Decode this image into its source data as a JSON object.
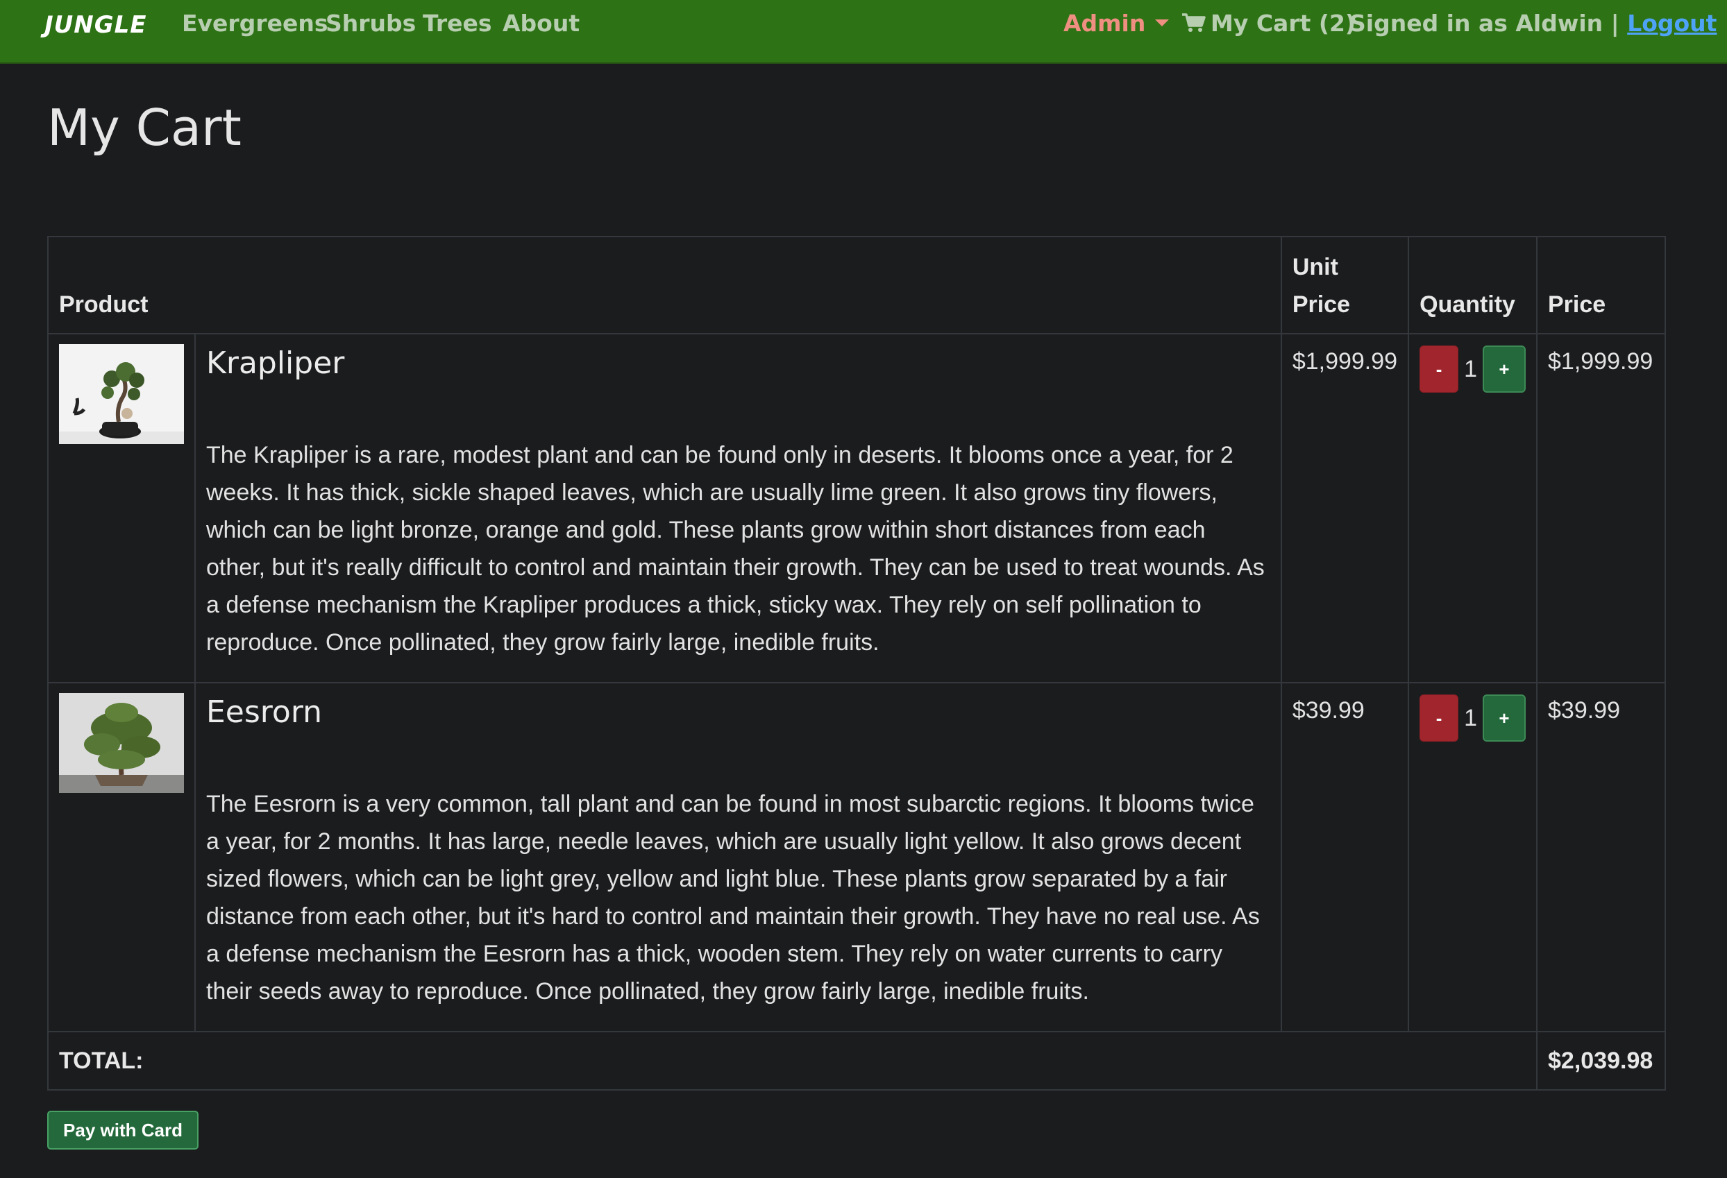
{
  "navbar": {
    "brand": "JUNGLE",
    "links": [
      "Evergreens",
      "Shrubs",
      "Trees",
      "About"
    ],
    "admin_label": "Admin",
    "cart_label": "My Cart (2)",
    "signed_in": "Signed in as Aldwin |",
    "logout": "Logout",
    "colors": {
      "bar": "#2e7216",
      "admin": "#ef8f81",
      "logout": "#4fa3f7"
    }
  },
  "page": {
    "title": "My Cart"
  },
  "table": {
    "headers": {
      "product": "Product",
      "unit_price": "Unit Price",
      "quantity": "Quantity",
      "price": "Price"
    },
    "items": [
      {
        "name": "Krapliper",
        "description": "The Krapliper is a rare, modest plant and can be found only in deserts. It blooms once a year, for 2 weeks. It has thick, sickle shaped leaves, which are usually lime green. It also grows tiny flowers, which can be light bronze, orange and gold. These plants grow within short distances from each other, but it's really difficult to control and maintain their growth. They can be used to treat wounds. As a defense mechanism the Krapliper produces a thick, sticky wax. They rely on self pollination to reproduce. Once pollinated, they grow fairly large, inedible fruits.",
        "unit_price": "$1,999.99",
        "quantity": "1",
        "price": "$1,999.99",
        "minus_label": "-",
        "plus_label": "+"
      },
      {
        "name": "Eesrorn",
        "description": "The Eesrorn is a very common, tall plant and can be found in most subarctic regions. It blooms twice a year, for 2 months. It has large, needle leaves, which are usually light yellow. It also grows decent sized flowers, which can be light grey, yellow and light blue. These plants grow separated by a fair distance from each other, but it's hard to control and maintain their growth. They have no real use. As a defense mechanism the Eesrorn has a thick, wooden stem. They rely on water currents to carry their seeds away to reproduce. Once pollinated, they grow fairly large, inedible fruits.",
        "unit_price": "$39.99",
        "quantity": "1",
        "price": "$39.99",
        "minus_label": "-",
        "plus_label": "+"
      }
    ],
    "total_label": "TOTAL:",
    "total_value": "$2,039.98"
  },
  "actions": {
    "pay_label": "Pay with Card"
  }
}
